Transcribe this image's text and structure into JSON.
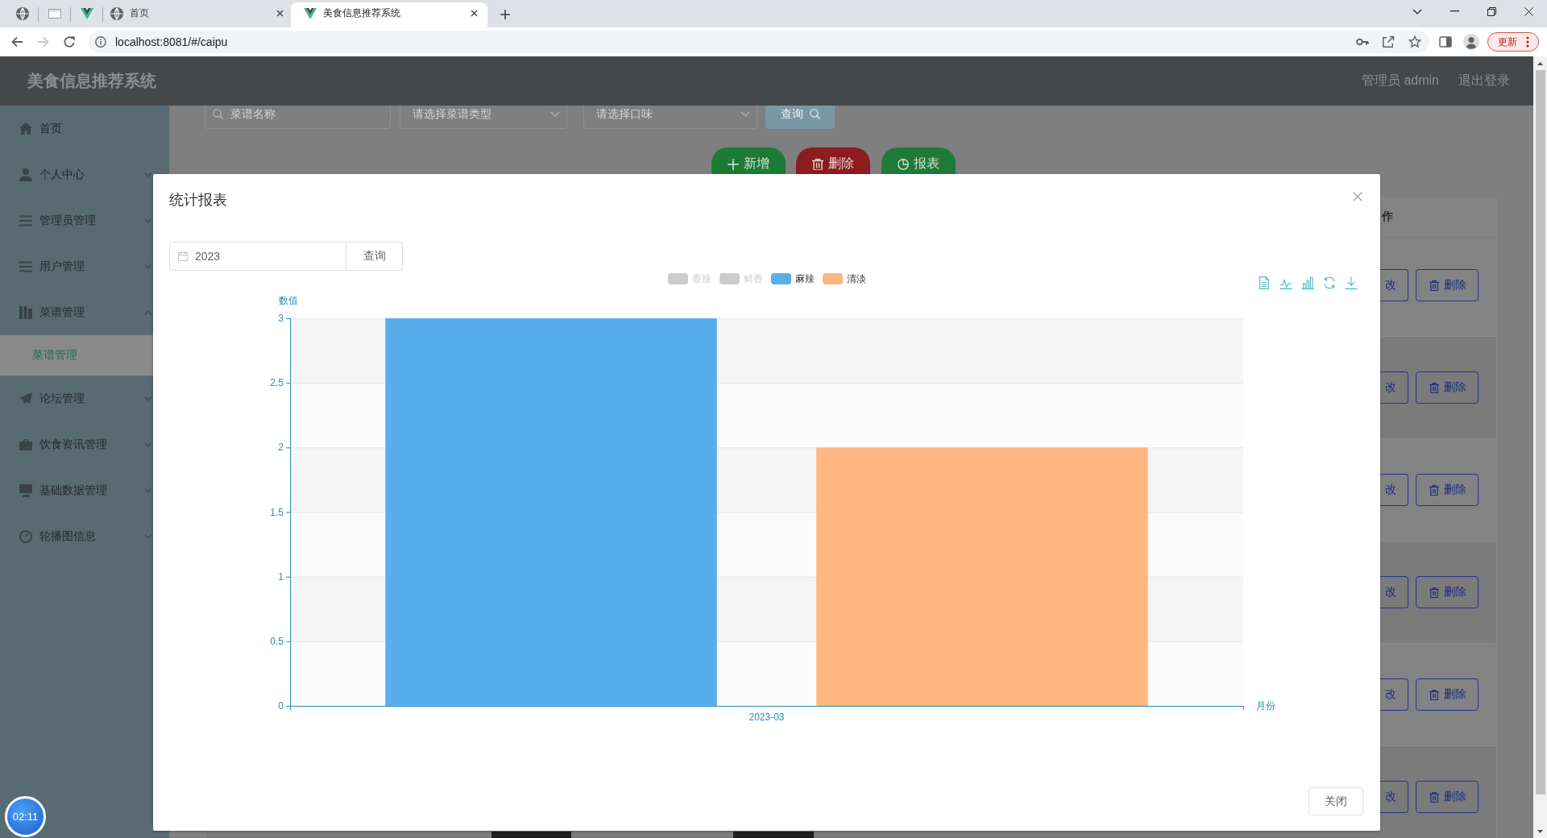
{
  "browser": {
    "tabs": [
      {
        "kind": "pinned",
        "selected": false
      },
      {
        "kind": "pinned",
        "selected": false
      },
      {
        "kind": "pinned",
        "selected": false
      },
      {
        "kind": "page",
        "title": "首页",
        "selected": false
      },
      {
        "kind": "page",
        "title": "美食信息推荐系统",
        "selected": true
      }
    ],
    "navigation": [
      {
        "kind": "back",
        "disabled": false
      },
      {
        "kind": "forward",
        "disabled": true
      }
    ],
    "address": "localhost:8081/#/caipu",
    "update_button": "更新"
  },
  "header": {
    "title": "美食信息推荐系统",
    "user": "管理员 admin",
    "logout": "退出登录"
  },
  "sidebar": {
    "items": [
      {
        "kind": "link",
        "label": "首页",
        "selected": false
      },
      {
        "kind": "menu",
        "label": "个人中心",
        "selected": false,
        "expanded": false
      },
      {
        "kind": "menu",
        "label": "管理员管理",
        "selected": false,
        "expanded": false
      },
      {
        "kind": "menu",
        "label": "用户管理",
        "selected": false,
        "expanded": false
      },
      {
        "kind": "menu",
        "label": "菜谱管理",
        "selected": false,
        "expanded": true,
        "children": [
          {
            "label": "菜谱管理",
            "selected": true
          }
        ]
      },
      {
        "kind": "menu",
        "label": "论坛管理",
        "selected": false,
        "expanded": false
      },
      {
        "kind": "menu",
        "label": "饮食资讯管理",
        "selected": false,
        "expanded": false
      },
      {
        "kind": "menu",
        "label": "基础数据管理",
        "selected": false,
        "expanded": false
      },
      {
        "kind": "menu",
        "label": "轮播图信息",
        "selected": false,
        "expanded": false
      }
    ]
  },
  "search": {
    "filters": [
      {
        "kind": "text",
        "placeholder": "菜谱名称"
      },
      {
        "kind": "select",
        "placeholder": "请选择菜谱类型"
      },
      {
        "kind": "select",
        "placeholder": "请选择口味"
      }
    ],
    "button": "查询"
  },
  "actions": [
    {
      "kind": "add",
      "label": "新增"
    },
    {
      "kind": "delete",
      "label": "删除"
    },
    {
      "kind": "report",
      "label": "报表"
    }
  ],
  "table": {
    "columns": [
      "作"
    ],
    "rows": [
      {
        "edit": "改",
        "delete": "删除"
      },
      {
        "edit": "改",
        "delete": "删除"
      },
      {
        "edit": "改",
        "delete": "删除"
      },
      {
        "edit": "改",
        "delete": "删除"
      },
      {
        "edit": "改",
        "delete": "删除"
      },
      {
        "edit": "改",
        "delete": "删除"
      }
    ]
  },
  "dialog": {
    "title": "统计报表",
    "year": "2023",
    "query_button": "查询",
    "legend": [
      {
        "label": "香辣",
        "selected": false
      },
      {
        "label": "鲜香",
        "selected": false
      },
      {
        "label": "麻辣",
        "selected": true,
        "color": "#58aeec"
      },
      {
        "label": "清淡",
        "selected": true,
        "color": "#ffb67f"
      }
    ],
    "chart_data": {
      "type": "bar",
      "grid": true,
      "xlabel": "月份",
      "ylabel": "数值",
      "categories": [
        "2023-03"
      ],
      "series": [
        {
          "color": "#58aeec",
          "values": [
            3
          ]
        },
        {
          "color": "#ffb67f",
          "values": [
            2
          ]
        }
      ],
      "ylim": [
        0,
        3
      ],
      "yticks": [
        0,
        0.5,
        1,
        1.5,
        2,
        2.5,
        3
      ]
    },
    "close_button": "关闭"
  },
  "timer": "02:11"
}
